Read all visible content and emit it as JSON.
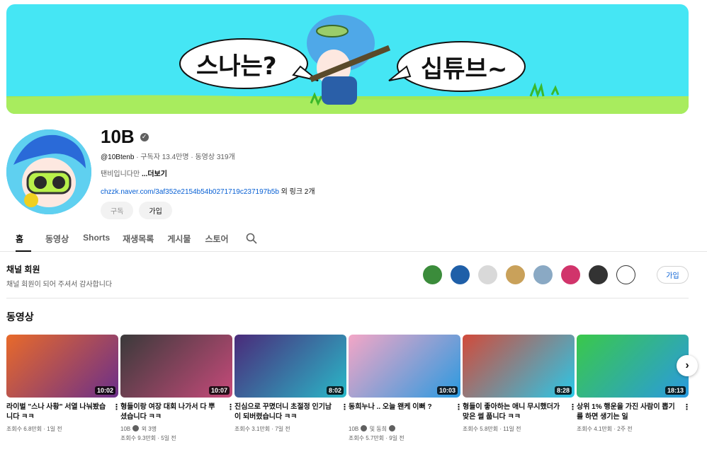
{
  "banner": {
    "left_bubble": "스나는?",
    "right_bubble": "십튜브~"
  },
  "channel": {
    "name": "10B",
    "handle": "@10Btenb",
    "meta": "· 구독자 13.4만명 · 동영상 319개",
    "description": "탠비입니다만 ",
    "more": "...더보기",
    "link": "chzzk.naver.com/3af352e2154b54b0271719c237197b5b",
    "link_suffix": " 외 링크 2개",
    "subscribe_label": "구독",
    "join_label": "가입"
  },
  "tabs": [
    "홈",
    "동영상",
    "Shorts",
    "재생목록",
    "게시물",
    "스토어"
  ],
  "members": {
    "title": "채널 회원",
    "subtitle": "채널 회원이 되어 주셔서 감사합니다",
    "join_label": "가입",
    "avatar_colors": [
      "#3b8c3b",
      "#1f5fa8",
      "#d9d9d9",
      "#c9a15a",
      "#8aa9c4",
      "#d1346b",
      "#333333",
      "#ffffff"
    ]
  },
  "section_title": "동영상",
  "videos": [
    {
      "title": "라이벌 \"스나 사황\" 서열 나눠봤습니다 ㅋㅋ",
      "duration": "10:02",
      "channel": "",
      "views": "조회수 6.8만회 · 1일 전",
      "color1": "#e86a2a",
      "color2": "#6b2f8a"
    },
    {
      "title": "형들이랑 여장 대회 나가서 다 뿌셨습니다 ㅋㅋ",
      "duration": "10:07",
      "channel": "10B",
      "channel_extra": "외 3명",
      "views": "조회수 9.3만회 · 5일 전",
      "color1": "#3a3a3a",
      "color2": "#c64a7a"
    },
    {
      "title": "진심으로 꾸몄더니 초절정 인기남이 되버렸습니다 ㅋㅋ",
      "duration": "8:02",
      "channel": "",
      "views": "조회수 3.1만회 · 7일 전",
      "color1": "#4a2a7a",
      "color2": "#2ab8c8"
    },
    {
      "title": "동희누나 .. 오늘 왠케 이뻐 ?",
      "duration": "10:03",
      "channel": "10B",
      "channel_extra": "및 동희",
      "views": "조회수 5.7만회 · 9일 전",
      "color1": "#f4a6c6",
      "color2": "#2a9ae0"
    },
    {
      "title": "형들이 좋아하는 애니 무시했더가 맞은 썰 풉니다 ㅋㅋ",
      "duration": "8:28",
      "channel": "",
      "views": "조회수 5.8만회 · 11일 전",
      "color1": "#d24a3a",
      "color2": "#2ac8e8"
    },
    {
      "title": "상위 1% 행운을 가진 사람이 뽑기를 하면 생기는 일",
      "duration": "18:13",
      "channel": "",
      "views": "조회수 4.1만회 · 2주 전",
      "color1": "#3ac84a",
      "color2": "#2a9ae0"
    }
  ]
}
